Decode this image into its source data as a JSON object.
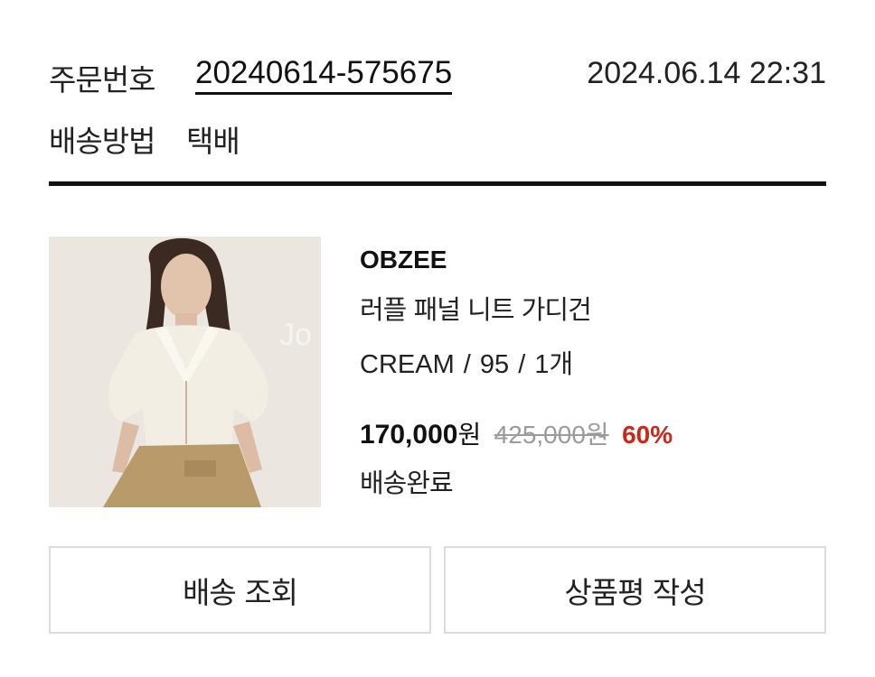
{
  "order": {
    "number_label": "주문번호",
    "number": "20240614-575675",
    "datetime": "2024.06.14 22:31",
    "shipping_label": "배송방법",
    "shipping_method": "택배"
  },
  "product": {
    "brand": "OBZEE",
    "name": "러플 패널 니트 가디건",
    "color": "CREAM",
    "size": "95",
    "quantity": "1개",
    "price": "170,000",
    "price_unit": "원",
    "original_price": "425,000원",
    "discount": "60%",
    "status": "배송완료",
    "image_watermark": "Jo"
  },
  "actions": {
    "track_label": "배송 조회",
    "review_label": "상품평 작성"
  },
  "colors": {
    "discount": "#c9281a",
    "strike": "#9b9b9b",
    "divider": "#111111",
    "button_border": "#dcdcdc"
  }
}
